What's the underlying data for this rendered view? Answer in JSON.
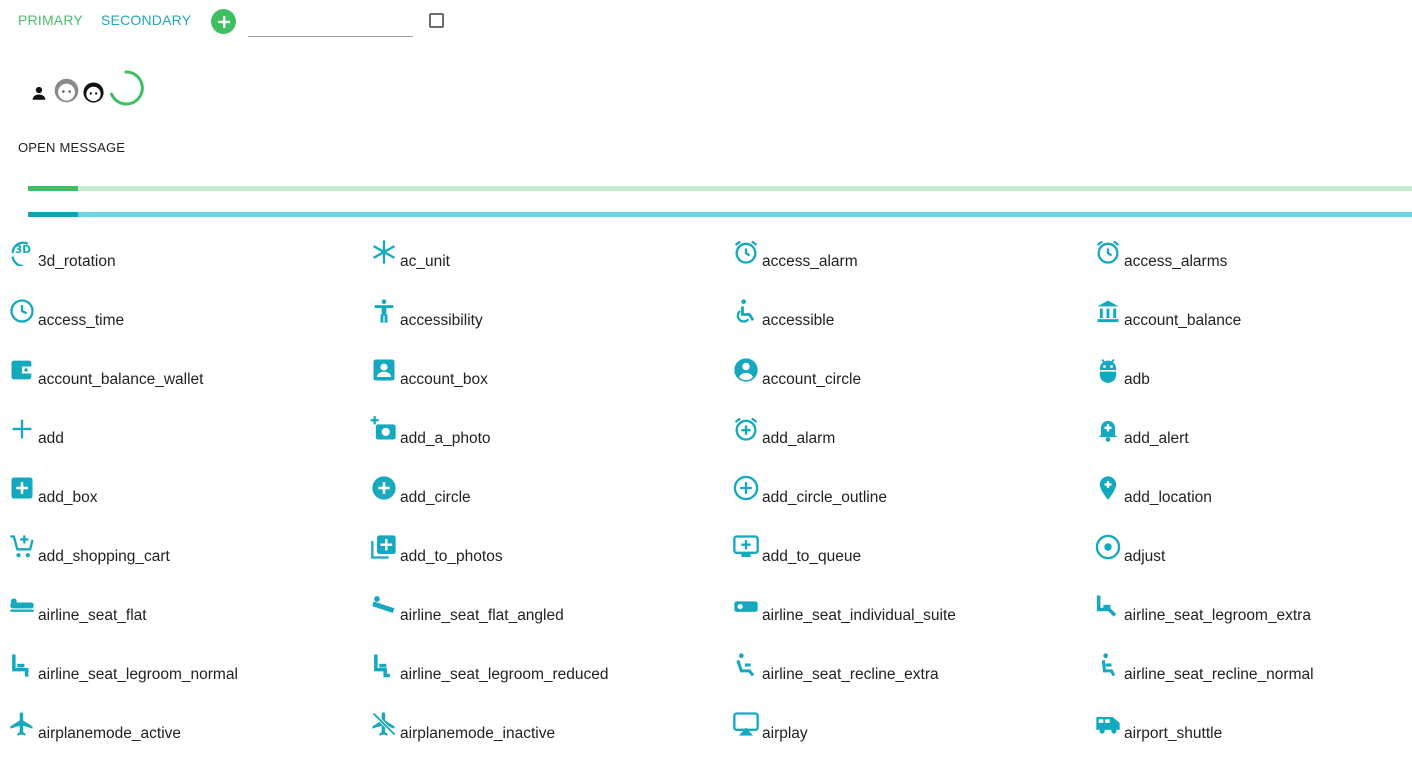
{
  "toolbar": {
    "primary_label": "PRIMARY",
    "secondary_label": "SECONDARY",
    "add_icon": "add-icon",
    "input_value": "",
    "checkbox_checked": false
  },
  "avatars": [
    "person-icon",
    "face-icon",
    "face-icon",
    "spinner"
  ],
  "open_message_label": "OPEN MESSAGE",
  "progress": {
    "primary_value": 0.036,
    "secondary_value": 0.036
  },
  "colors": {
    "primary": "#3fbf64",
    "primary_light": "#c5ebce",
    "secondary": "#17a2b4",
    "secondary_light": "#6ed4e0",
    "icon": "#15a9bf"
  },
  "icons": [
    {
      "name": "3d_rotation"
    },
    {
      "name": "ac_unit"
    },
    {
      "name": "access_alarm"
    },
    {
      "name": "access_alarms"
    },
    {
      "name": "access_time"
    },
    {
      "name": "accessibility"
    },
    {
      "name": "accessible"
    },
    {
      "name": "account_balance"
    },
    {
      "name": "account_balance_wallet"
    },
    {
      "name": "account_box"
    },
    {
      "name": "account_circle"
    },
    {
      "name": "adb"
    },
    {
      "name": "add"
    },
    {
      "name": "add_a_photo"
    },
    {
      "name": "add_alarm"
    },
    {
      "name": "add_alert"
    },
    {
      "name": "add_box"
    },
    {
      "name": "add_circle"
    },
    {
      "name": "add_circle_outline"
    },
    {
      "name": "add_location"
    },
    {
      "name": "add_shopping_cart"
    },
    {
      "name": "add_to_photos"
    },
    {
      "name": "add_to_queue"
    },
    {
      "name": "adjust"
    },
    {
      "name": "airline_seat_flat"
    },
    {
      "name": "airline_seat_flat_angled"
    },
    {
      "name": "airline_seat_individual_suite"
    },
    {
      "name": "airline_seat_legroom_extra"
    },
    {
      "name": "airline_seat_legroom_normal"
    },
    {
      "name": "airline_seat_legroom_reduced"
    },
    {
      "name": "airline_seat_recline_extra"
    },
    {
      "name": "airline_seat_recline_normal"
    },
    {
      "name": "airplanemode_active"
    },
    {
      "name": "airplanemode_inactive"
    },
    {
      "name": "airplay"
    },
    {
      "name": "airport_shuttle"
    }
  ]
}
